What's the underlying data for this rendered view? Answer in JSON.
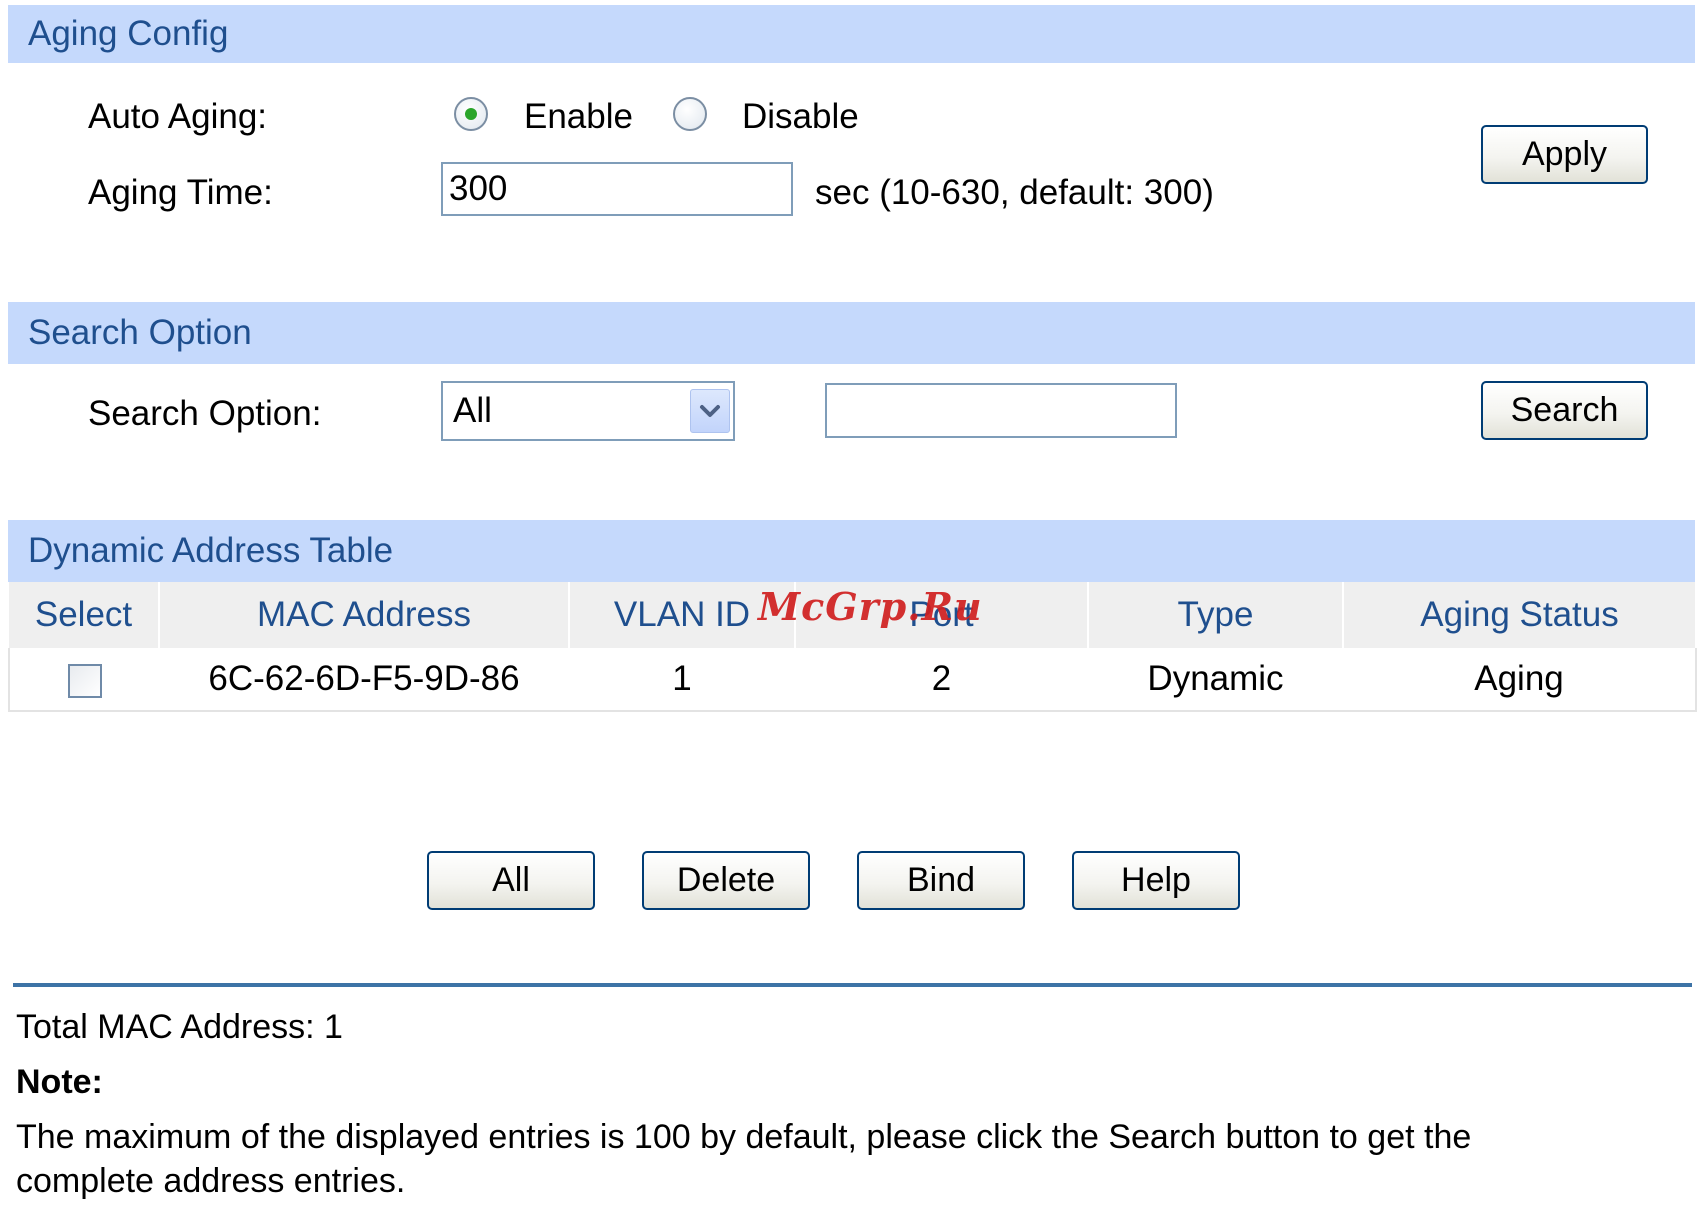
{
  "aging_config": {
    "title": "Aging Config",
    "auto_aging_label": "Auto Aging:",
    "enable_label": "Enable",
    "disable_label": "Disable",
    "auto_aging_selected": "Enable",
    "aging_time_label": "Aging Time:",
    "aging_time_value": "300",
    "aging_time_hint": "sec (10-630, default: 300)",
    "apply_label": "Apply"
  },
  "search_option": {
    "title": "Search Option",
    "label": "Search Option:",
    "selected": "All",
    "search_text": "",
    "search_button": "Search"
  },
  "dynamic_table": {
    "title": "Dynamic Address Table",
    "columns": [
      "Select",
      "MAC Address",
      "VLAN ID",
      "Port",
      "Type",
      "Aging Status"
    ],
    "rows": [
      {
        "selected": false,
        "mac": "6C-62-6D-F5-9D-86",
        "vlan": "1",
        "port": "2",
        "type": "Dynamic",
        "aging_status": "Aging"
      }
    ]
  },
  "actions": {
    "all": "All",
    "delete": "Delete",
    "bind": "Bind",
    "help": "Help"
  },
  "footer": {
    "total_label": "Total MAC Address: 1",
    "note_title": "Note:",
    "note_line1": "The maximum of the displayed entries is 100 by default, please click the Search button to get the",
    "note_line2": "complete address entries."
  },
  "watermark": "McGrp.Ru",
  "colors": {
    "section_bar": "#c5d9fc",
    "section_text": "#1f4f8e",
    "header_bg": "#efefef",
    "rule": "#3d73a6",
    "radio_dot": "#2aa52a",
    "watermark": "#d01f1f"
  },
  "icons": {
    "radio_checked": "radio-checked-icon",
    "radio_unchecked": "radio-unchecked-icon",
    "dropdown": "chevron-down-icon",
    "checkbox": "checkbox-icon"
  }
}
